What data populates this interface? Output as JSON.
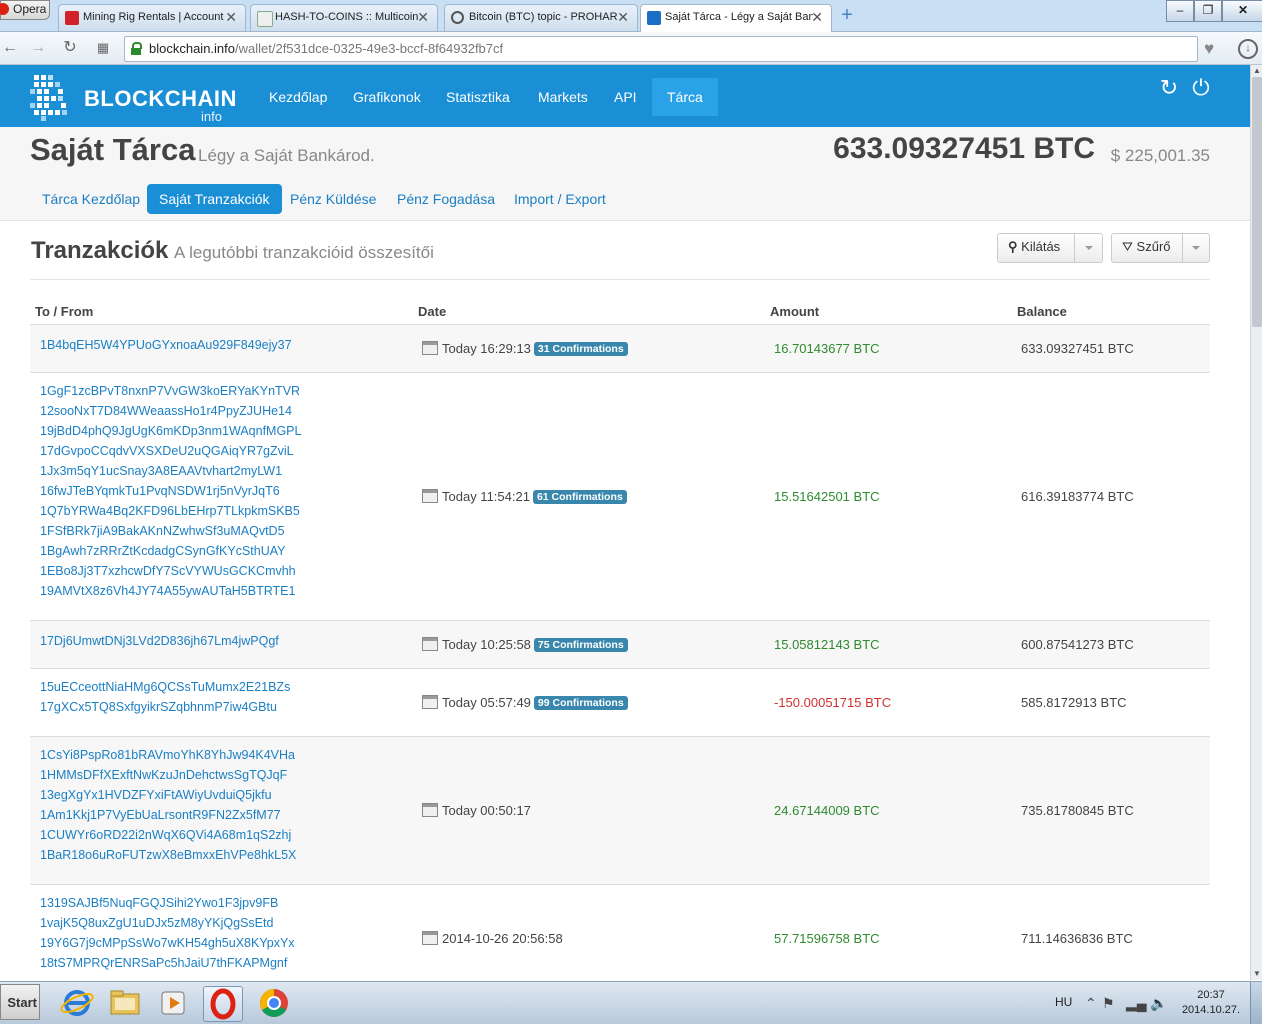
{
  "browser": {
    "menu_label": "Opera",
    "tabs": [
      {
        "label": "Mining Rig Rentals | Account"
      },
      {
        "label": "HASH-TO-COINS :: Multicoin"
      },
      {
        "label": "Bitcoin (BTC) topic - PROHARDVER"
      },
      {
        "label": "Saját Tárca - Légy a Saját Bankárod"
      }
    ],
    "url_host": "blockchain.info",
    "url_path": "/wallet/2f531dce-0325-49e3-bccf-8f64932fb7cf"
  },
  "header": {
    "logo_word": "BLOCKCHAIN",
    "logo_sub": "info",
    "nav": [
      "Kezdőlap",
      "Grafikonok",
      "Statisztika",
      "Markets",
      "API",
      "Tárca"
    ]
  },
  "wallet": {
    "title": "Saját Tárca",
    "subtitle": "Légy a Saját Bankárod.",
    "balance_btc": "633.09327451 BTC",
    "balance_usd": "$ 225,001.35",
    "subnav": [
      "Tárca Kezdőlap",
      "Saját Tranzakciók",
      "Pénz Küldése",
      "Pénz Fogadása",
      "Import / Export"
    ]
  },
  "transactions": {
    "title": "Tranzakciók",
    "subtitle": "A legutóbbi tranzakcióid összesítői",
    "view_button": "Kilátás",
    "filter_button": "Szűrő",
    "columns": [
      "To / From",
      "Date",
      "Amount",
      "Balance"
    ],
    "rows": [
      {
        "addresses": [
          "1B4bqEH5W4YPUoGYxnoaAu929F849ejy37"
        ],
        "date": "Today 16:29:13",
        "confirmations": "31 Confirmations",
        "amount": "16.70143677 BTC",
        "balance": "633.09327451 BTC"
      },
      {
        "addresses": [
          "1GgF1zcBPvT8nxnP7VvGW3koERYaKYnTVR",
          "12sooNxT7D84WWeaassHo1r4PpyZJUHe14",
          "19jBdD4phQ9JgUgK6mKDp3nm1WAqnfMGPL",
          "17dGvpoCCqdvVXSXDeU2uQGAiqYR7gZviL",
          "1Jx3m5qY1ucSnay3A8EAAVtvhart2myLW1",
          "16fwJTeBYqmkTu1PvqNSDW1rj5nVyrJqT6",
          "1Q7bYRWa4Bq2KFD96LbEHrp7TLkpkmSKB5",
          "1FSfBRk7jiA9BakAKnNZwhwSf3uMAQvtD5",
          "1BgAwh7zRRrZtKcdadgCSynGfKYcSthUAY",
          "1EBo8Jj3T7xzhcwDfY7ScVYWUsGCKCmvhh",
          "19AMVtX8z6Vh4JY74A55ywAUTaH5BTRTE1"
        ],
        "date": "Today 11:54:21",
        "confirmations": "61 Confirmations",
        "amount": "15.51642501 BTC",
        "balance": "616.39183774 BTC"
      },
      {
        "addresses": [
          "17Dj6UmwtDNj3LVd2D836jh67Lm4jwPQgf"
        ],
        "date": "Today 10:25:58",
        "confirmations": "75 Confirmations",
        "amount": "15.05812143 BTC",
        "balance": "600.87541273 BTC"
      },
      {
        "addresses": [
          "15uECceottNiaHMg6QCSsTuMumx2E21BZs",
          "17gXCx5TQ8SxfgyikrSZqbhnmP7iw4GBtu"
        ],
        "date": "Today 05:57:49",
        "confirmations": "99 Confirmations",
        "amount": "-150.00051715 BTC",
        "balance": "585.8172913 BTC"
      },
      {
        "addresses": [
          "1CsYi8PspRo81bRAVmoYhK8YhJw94K4VHa",
          "1HMMsDFfXExftNwKzuJnDehctwsSgTQJqF",
          "13egXgYx1HVDZFYxiFtAWiyUvduiQ5jkfu",
          "1Am1Kkj1P7VyEbUaLrsontR9FN2Zx5fM77",
          "1CUWYr6oRD22i2nWqX6QVi4A68m1qS2zhj",
          "1BaR18o6uRoFUTzwX8eBmxxEhVPe8hkL5X"
        ],
        "date": "Today 00:50:17",
        "confirmations": "",
        "amount": "24.67144009 BTC",
        "balance": "735.81780845 BTC"
      },
      {
        "addresses": [
          "1319SAJBf5NuqFGQJSihi2Ywo1F3jpv9FB",
          "1vajK5Q8uxZgU1uDJx5zM8yYKjQgSsEtd",
          "19Y6G7j9cMPpSsWo7wKH54gh5uX8KYpxYx",
          "18tS7MPRQrENRSaPc5hJaiU7thFKAPMgnf"
        ],
        "date": "2014-10-26 20:56:58",
        "confirmations": "",
        "amount": "57.71596758 BTC",
        "balance": "711.14636836 BTC"
      }
    ]
  },
  "taskbar": {
    "start_label": "Start",
    "lang": "HU",
    "time": "20:37",
    "date": "2014.10.27."
  },
  "colors": {
    "header_blue": "#1a8fd5",
    "link_blue": "#1b7fc4",
    "amount_positive": "#2e8b2e",
    "amount_negative": "#d43030",
    "badge": "#3a87ad"
  }
}
